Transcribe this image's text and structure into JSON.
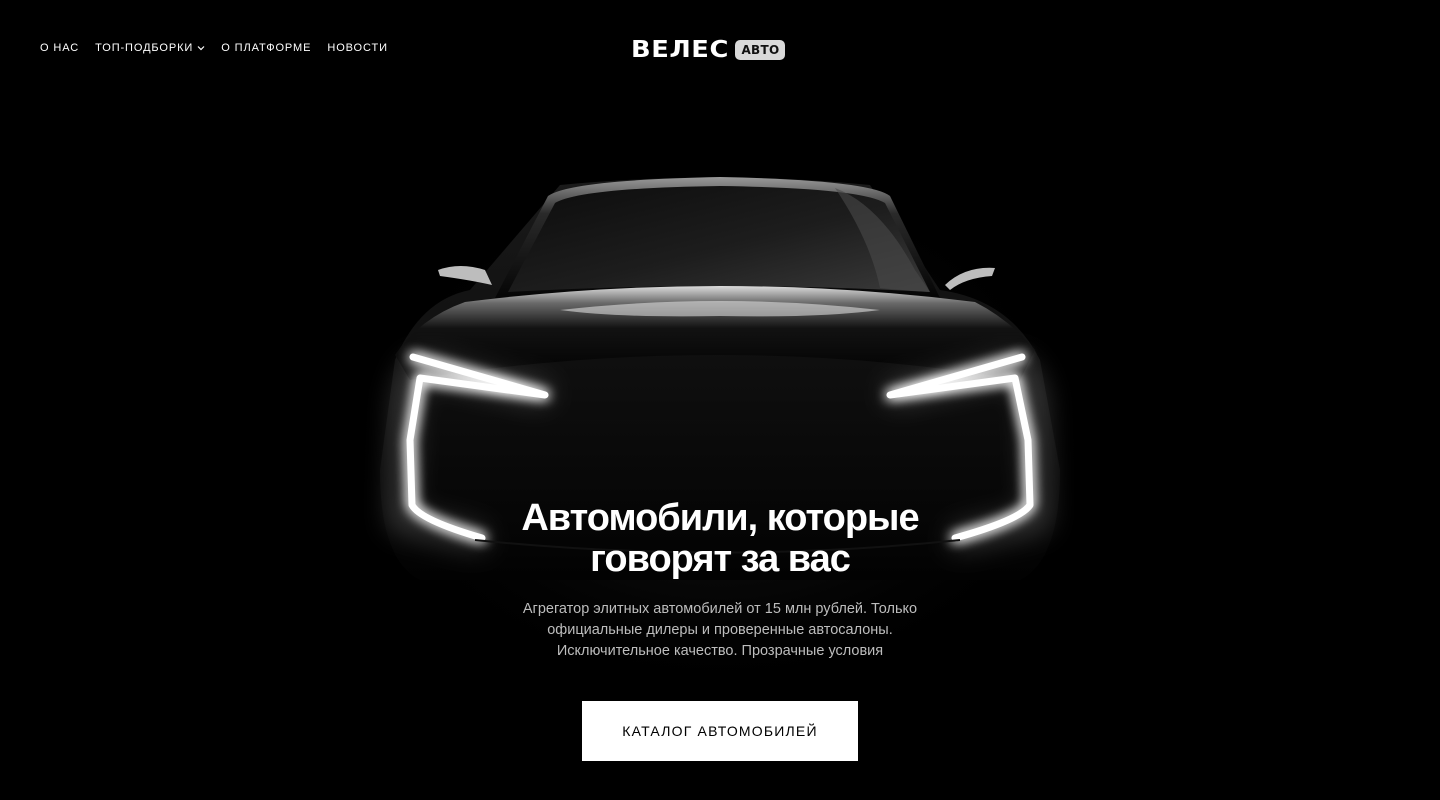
{
  "header": {
    "nav": [
      {
        "label": "О НАС"
      },
      {
        "label": "ТОП-ПОДБОРКИ",
        "has_dropdown": true
      },
      {
        "label": "О ПЛАТФОРМЕ"
      },
      {
        "label": "НОВОСТИ"
      }
    ],
    "logo": {
      "word": "ВЕЛЕС",
      "badge": "АВТО"
    }
  },
  "hero": {
    "title_line1": "Автомобили, которые",
    "title_line2": "говорят за вас",
    "subtitle_line1": "Агрегатор элитных автомобилей от 15 млн рублей. Только",
    "subtitle_line2": "официальные дилеры и проверенные автосалоны.",
    "subtitle_line3": "Исключительное качество. Прозрачные условия",
    "cta_label": "КАТАЛОГ АВТОМОБИЛЕЙ",
    "background_image": "car-front-silhouette-with-led-headlights"
  },
  "colors": {
    "background": "#000000",
    "text": "#ffffff",
    "subtitle": "#bdbdbd",
    "cta_background": "#ffffff",
    "cta_text": "#000000",
    "logo_badge": "#d9d9d9"
  }
}
